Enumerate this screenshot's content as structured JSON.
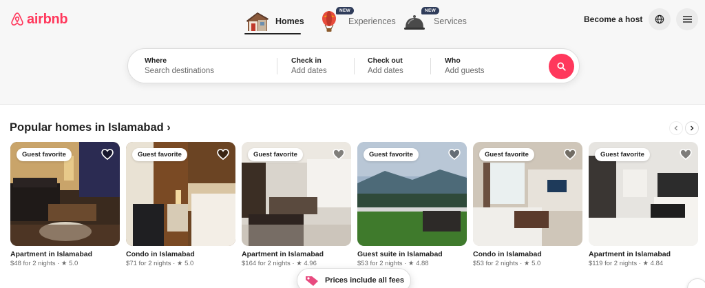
{
  "brand": {
    "logo_text": "airbnb",
    "accent_color": "#ff385c"
  },
  "nav": {
    "tabs": [
      {
        "label": "Homes",
        "icon": "house-icon",
        "active": true
      },
      {
        "label": "Experiences",
        "icon": "hot-air-balloon-icon",
        "badge": "NEW"
      },
      {
        "label": "Services",
        "icon": "service-bell-icon",
        "badge": "NEW"
      }
    ],
    "host_label": "Become a host",
    "globe_icon": "globe-icon",
    "menu_icon": "hamburger-menu-icon"
  },
  "search": {
    "where_label": "Where",
    "where_placeholder": "Search destinations",
    "checkin_label": "Check in",
    "checkin_placeholder": "Add dates",
    "checkout_label": "Check out",
    "checkout_placeholder": "Add dates",
    "who_label": "Who",
    "who_placeholder": "Add guests",
    "button_icon": "search-icon"
  },
  "section": {
    "title": "Popular homes in Islamabad ›",
    "listings": [
      {
        "badge": "Guest favorite",
        "title": "Apartment in Islamabad",
        "subtitle": "$48 for 2 nights · ★ 5.0"
      },
      {
        "badge": "Guest favorite",
        "title": "Condo in Islamabad",
        "subtitle": "$71 for 2 nights · ★ 5.0"
      },
      {
        "badge": "Guest favorite",
        "title": "Apartment in Islamabad",
        "subtitle": "$164 for 2 nights · ★ 4.96"
      },
      {
        "badge": "Guest favorite",
        "title": "Guest suite in Islamabad",
        "subtitle": "$53 for 2 nights · ★ 4.88"
      },
      {
        "badge": "Guest favorite",
        "title": "Condo in Islamabad",
        "subtitle": "$53 for 2 nights · ★ 5.0"
      },
      {
        "badge": "Guest favorite",
        "title": "Apartment in Islamabad",
        "subtitle": "$119 for 2 nights · ★ 4.84"
      }
    ]
  },
  "fees_pill": {
    "label": "Prices include all fees",
    "icon": "price-tag-icon"
  }
}
